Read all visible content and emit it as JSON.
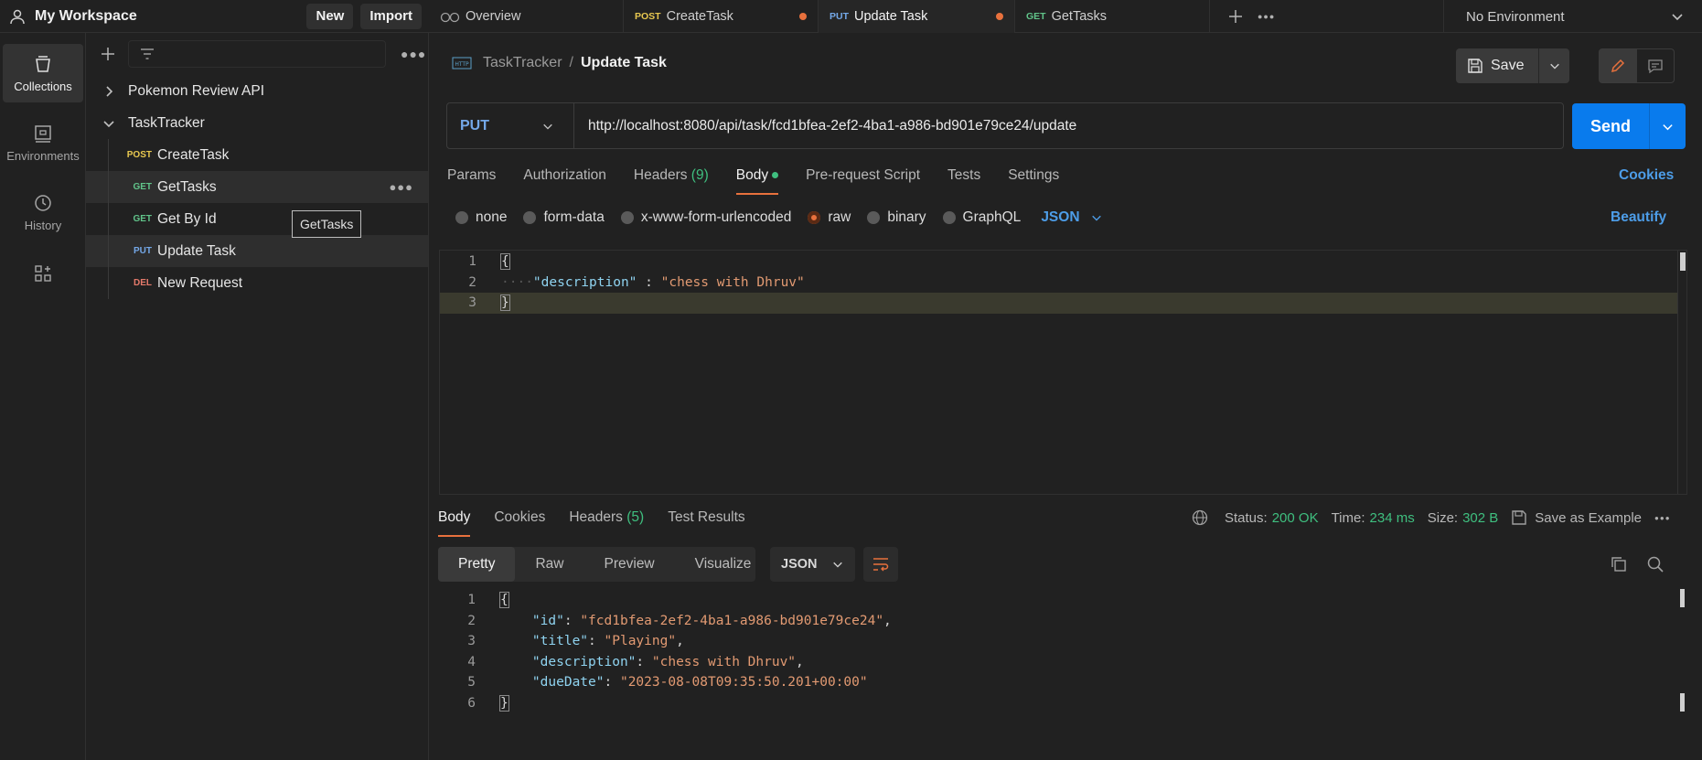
{
  "workspace": {
    "title": "My Workspace",
    "new_label": "New",
    "import_label": "Import"
  },
  "rail": [
    {
      "label": "Collections"
    },
    {
      "label": "Environments"
    },
    {
      "label": "History"
    }
  ],
  "sidebar": {
    "collections": [
      {
        "name": "Pokemon Review API"
      },
      {
        "name": "TaskTracker"
      }
    ],
    "requests": [
      {
        "method": "POST",
        "name": "CreateTask"
      },
      {
        "method": "GET",
        "name": "GetTasks"
      },
      {
        "method": "GET",
        "name": "Get By Id"
      },
      {
        "method": "PUT",
        "name": "Update Task"
      },
      {
        "method": "DEL",
        "name": "New Request"
      }
    ],
    "tooltip": "GetTasks"
  },
  "tabs": [
    {
      "method": "",
      "label": "Overview"
    },
    {
      "method": "POST",
      "label": "CreateTask"
    },
    {
      "method": "PUT",
      "label": "Update Task"
    },
    {
      "method": "GET",
      "label": "GetTasks"
    }
  ],
  "environment": "No Environment",
  "request": {
    "breadcrumb_parent": "TaskTracker",
    "breadcrumb_sep": "/",
    "title": "Update Task",
    "save_label": "Save",
    "method": "PUT",
    "url": "http://localhost:8080/api/task/fcd1bfea-2ef2-4ba1-a986-bd901e79ce24/update",
    "send_label": "Send",
    "tabs": {
      "params": "Params",
      "authorization": "Authorization",
      "headers": "Headers",
      "headers_count": "(9)",
      "body": "Body",
      "prerequest": "Pre-request Script",
      "tests": "Tests",
      "settings": "Settings"
    },
    "cookies_label": "Cookies",
    "body_types": {
      "none": "none",
      "form_data": "form-data",
      "urlencoded": "x-www-form-urlencoded",
      "raw": "raw",
      "binary": "binary",
      "graphql": "GraphQL"
    },
    "body_format": "JSON",
    "beautify_label": "Beautify",
    "body_lines": {
      "l1": "{",
      "l2_key": "\"description\"",
      "l2_sep": " : ",
      "l2_val": "\"chess with Dhruv\"",
      "l3": "}"
    }
  },
  "response": {
    "tabs": {
      "body": "Body",
      "cookies": "Cookies",
      "headers": "Headers",
      "headers_count": "(5)",
      "test_results": "Test Results"
    },
    "status_label": "Status:",
    "status_value": "200 OK",
    "time_label": "Time:",
    "time_value": "234 ms",
    "size_label": "Size:",
    "size_value": "302 B",
    "save_example_label": "Save as Example",
    "view_tabs": {
      "pretty": "Pretty",
      "raw": "Raw",
      "preview": "Preview",
      "visualize": "Visualize"
    },
    "format": "JSON",
    "lines": {
      "l1": "{",
      "id_key": "\"id\"",
      "id_val": "\"fcd1bfea-2ef2-4ba1-a986-bd901e79ce24\"",
      "title_key": "\"title\"",
      "title_val": "\"Playing\"",
      "desc_key": "\"description\"",
      "desc_val": "\"chess with Dhruv\"",
      "due_key": "\"dueDate\"",
      "due_val": "\"2023-08-08T09:35:50.201+00:00\"",
      "l6": "}"
    }
  },
  "colors": {
    "accent": "#e8713d",
    "send_blue": "#097bed",
    "link_blue": "#4d9de8",
    "ok_green": "#3fbf7f"
  }
}
